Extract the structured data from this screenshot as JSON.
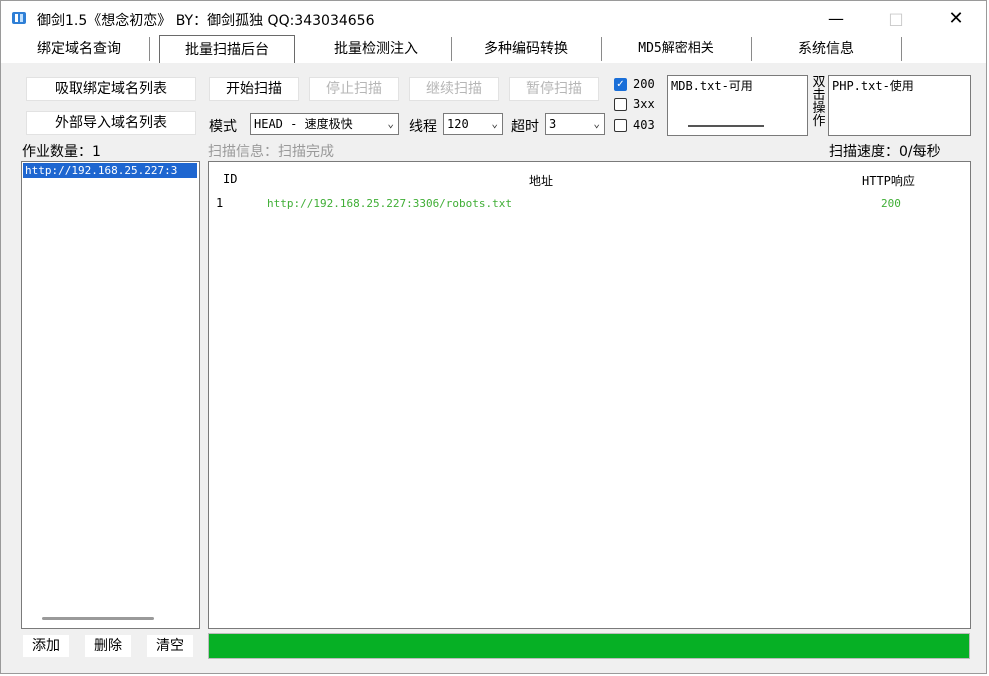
{
  "window": {
    "title": "御剑1.5《想念初恋》 BY：御剑孤独 QQ:343034656"
  },
  "tabs": [
    {
      "label": "绑定域名查询"
    },
    {
      "label": "批量扫描后台"
    },
    {
      "label": "批量检测注入"
    },
    {
      "label": "多种编码转换"
    },
    {
      "label": "MD5解密相关"
    },
    {
      "label": "系统信息"
    }
  ],
  "left": {
    "fetch_button": "吸取绑定域名列表",
    "import_button": "外部导入域名列表",
    "job_count": "作业数量：1",
    "list_items": [
      "http://192.168.25.227:3"
    ],
    "add_button": "添加",
    "delete_button": "删除",
    "clear_button": "清空"
  },
  "controls": {
    "start": "开始扫描",
    "stop": "停止扫描",
    "continue": "继续扫描",
    "pause": "暂停扫描",
    "mode_label": "模式",
    "mode_value": "HEAD - 速度极快",
    "threads_label": "线程",
    "threads_value": "120",
    "timeout_label": "超时",
    "timeout_value": "3"
  },
  "filters": [
    {
      "label": "200",
      "checked": true
    },
    {
      "label": "3xx",
      "checked": false
    },
    {
      "label": "403",
      "checked": false
    }
  ],
  "dicts": {
    "left_item": "MDB.txt-可用",
    "right_item": "PHP.txt-使用",
    "double_click_label": [
      "双",
      "击",
      "操",
      "作"
    ]
  },
  "status": {
    "scan_info": "扫描信息：扫描完成",
    "scan_speed": "扫描速度：0/每秒"
  },
  "results": {
    "headers": {
      "id": "ID",
      "address": "地址",
      "http": "HTTP响应"
    },
    "rows": [
      {
        "id": "1",
        "address": "http://192.168.25.227:3306/robots.txt",
        "http": "200"
      }
    ]
  },
  "progress": {
    "fraction": 1.0,
    "color": "#06b025"
  },
  "colors": {
    "accent": "#1e66d0",
    "result_text": "#3fae35"
  }
}
